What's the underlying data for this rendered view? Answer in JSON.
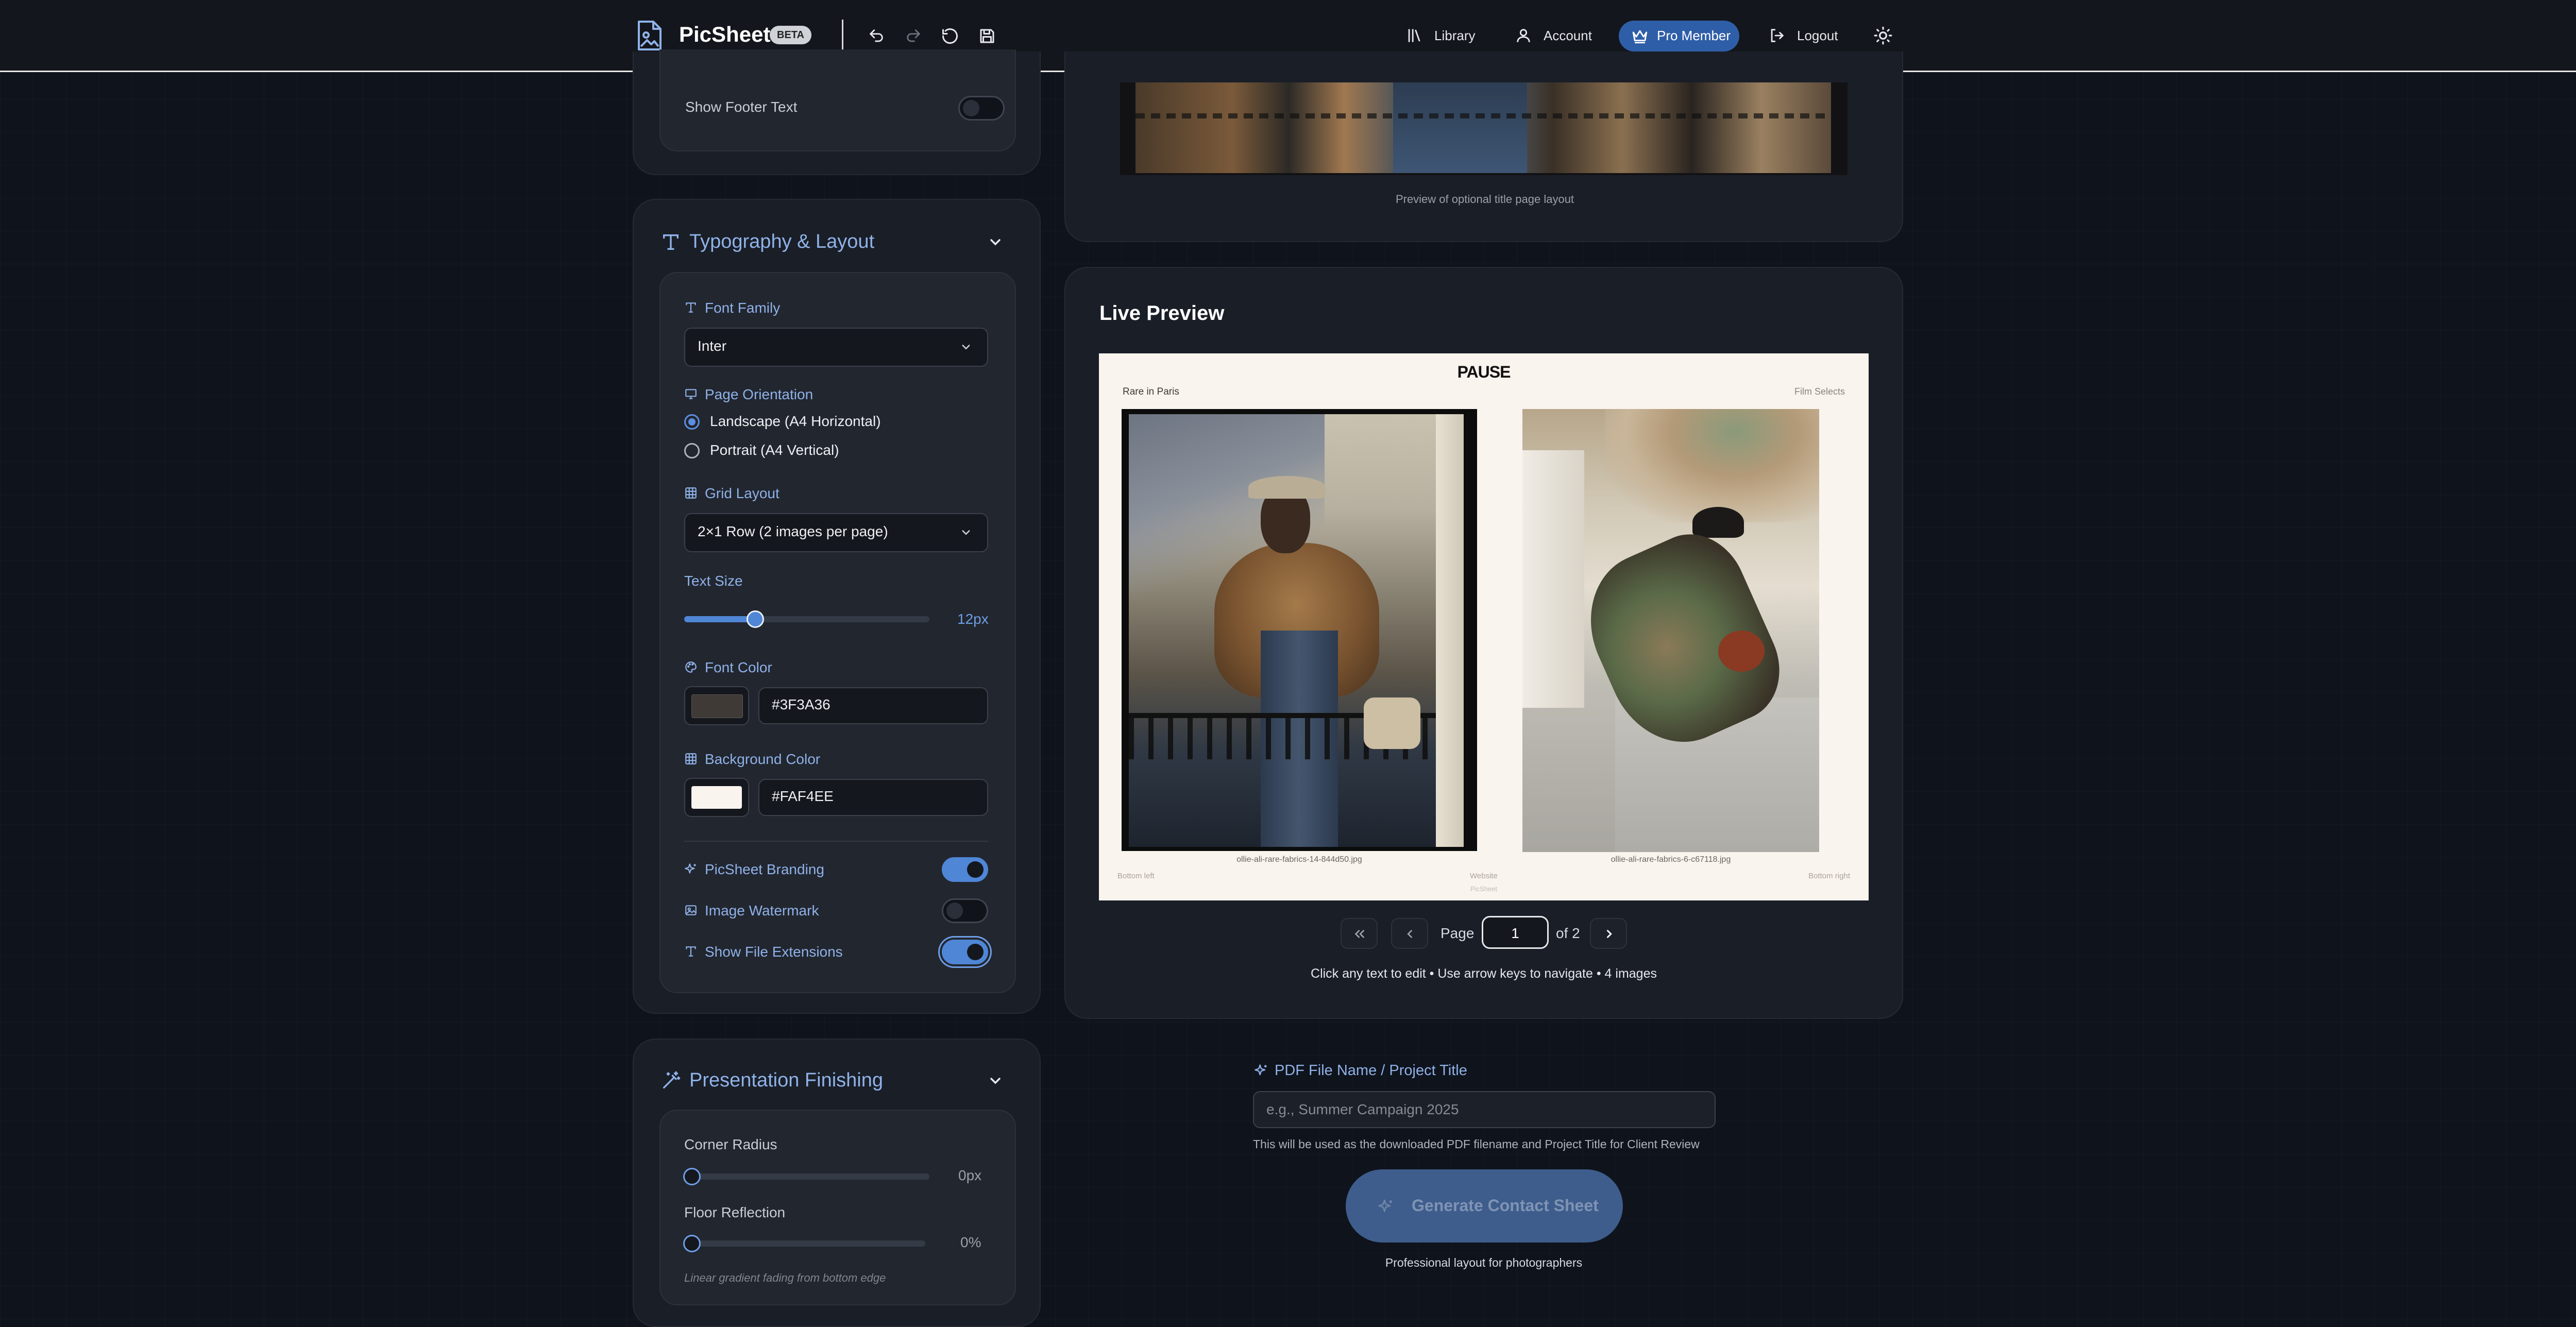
{
  "header": {
    "brand": "PicSheet",
    "badge": "BETA",
    "nav": {
      "library": "Library",
      "account": "Account",
      "pro": "Pro Member",
      "logout": "Logout"
    }
  },
  "footer_section": {
    "show_footer_label": "Show Footer Text",
    "show_footer_on": false
  },
  "typography": {
    "title": "Typography & Layout",
    "font_family_label": "Font Family",
    "font_family_value": "Inter",
    "orientation_label": "Page Orientation",
    "orientation_options": [
      "Landscape (A4 Horizontal)",
      "Portrait (A4 Vertical)"
    ],
    "orientation_selected": 0,
    "grid_label": "Grid Layout",
    "grid_value": "2×1 Row (2 images per page)",
    "text_size_label": "Text Size",
    "text_size_value": "12px",
    "text_size_fraction": 0.29,
    "font_color_label": "Font Color",
    "font_color_value": "#3F3A36",
    "bg_color_label": "Background Color",
    "bg_color_value": "#FAF4EE",
    "branding_label": "PicSheet Branding",
    "branding_on": true,
    "watermark_label": "Image Watermark",
    "watermark_on": false,
    "extensions_label": "Show File Extensions",
    "extensions_on": true
  },
  "finishing": {
    "title": "Presentation Finishing",
    "corner_label": "Corner Radius",
    "corner_value": "0px",
    "reflection_label": "Floor Reflection",
    "reflection_value": "0%",
    "reflection_hint": "Linear gradient fading from bottom edge"
  },
  "title_preview": {
    "caption": "Preview of optional title page layout"
  },
  "live_preview": {
    "title": "Live Preview",
    "sheet": {
      "logo": "PAUSE",
      "header_left": "Rare in Paris",
      "header_right": "Film Selects",
      "images": [
        {
          "filename": "ollie-ali-rare-fabrics-14-844d50.jpg"
        },
        {
          "filename": "ollie-ali-rare-fabrics-6-c67118.jpg"
        }
      ],
      "footer_left": "Bottom left",
      "footer_center": "Website",
      "footer_center_sub": "PicSheet",
      "footer_right": "Bottom right"
    },
    "pagination": {
      "page_label": "Page",
      "current": "1",
      "of": "of 2"
    },
    "hint": "Click any text to edit • Use arrow keys to navigate • 4 images"
  },
  "export": {
    "pdf_label": "PDF File Name / Project Title",
    "pdf_placeholder": "e.g., Summer Campaign 2025",
    "pdf_help": "This will be used as the downloaded PDF filename and Project Title for Client Review",
    "generate": "Generate Contact Sheet",
    "tagline": "Professional layout for photographers"
  },
  "colors": {
    "accent": "#4F86D6",
    "pro_badge": "#2F5EA8",
    "label_blue": "#8FB2E8",
    "sheet_bg": "#FAF4EE",
    "font_color": "#3F3A36"
  }
}
